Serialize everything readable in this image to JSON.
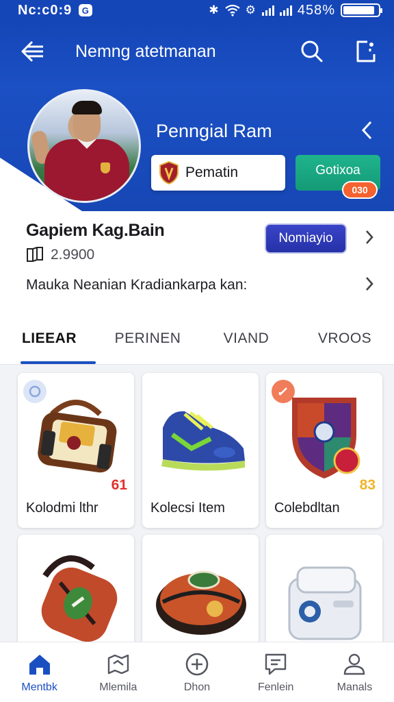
{
  "status_bar": {
    "time": "Nc:c0:9",
    "notif_glyph": "G",
    "battery": "458%",
    "battery_level": 0.9
  },
  "app_bar": {
    "title": "Nemng atetmanan"
  },
  "hero": {
    "name": "Penngial Ram",
    "primary_button": "Pematin",
    "secondary_button": "Gotixoa",
    "secondary_badge": "030"
  },
  "profile": {
    "username": "Gapiem Kag.Bain",
    "count": "2.9900",
    "badge_button": "Nomiayio",
    "description": "Mauka Neanian Kradiankarpa kan:"
  },
  "tabs": [
    {
      "label": "LIEEAR",
      "active": true
    },
    {
      "label": "PERINEN",
      "active": false
    },
    {
      "label": "VIAND",
      "active": false
    },
    {
      "label": "VROOS",
      "active": false
    }
  ],
  "items": [
    {
      "label": "Kolodmi lthr",
      "badge": "61",
      "badge_color": "#e0312c"
    },
    {
      "label": "Kolecsi Item",
      "badge": "",
      "badge_color": "#c8c8c8"
    },
    {
      "label": "Colebdltan",
      "badge": "83",
      "badge_color": "#f0b429"
    },
    {
      "label": "",
      "badge": "",
      "badge_color": ""
    },
    {
      "label": "",
      "badge": "",
      "badge_color": ""
    },
    {
      "label": "",
      "badge": "",
      "badge_color": ""
    }
  ],
  "bottom_nav": [
    {
      "label": "Mentbk",
      "icon": "home-icon",
      "active": true
    },
    {
      "label": "Mlemila",
      "icon": "map-icon",
      "active": false
    },
    {
      "label": "Dhon",
      "icon": "plus-circle-icon",
      "active": false
    },
    {
      "label": "Fenlein",
      "icon": "chat-icon",
      "active": false
    },
    {
      "label": "Manals",
      "icon": "person-icon",
      "active": false
    }
  ],
  "colors": {
    "primary": "#1a4fc2",
    "green": "#149a76",
    "orange": "#f4622f",
    "indigo": "#2531a8"
  }
}
